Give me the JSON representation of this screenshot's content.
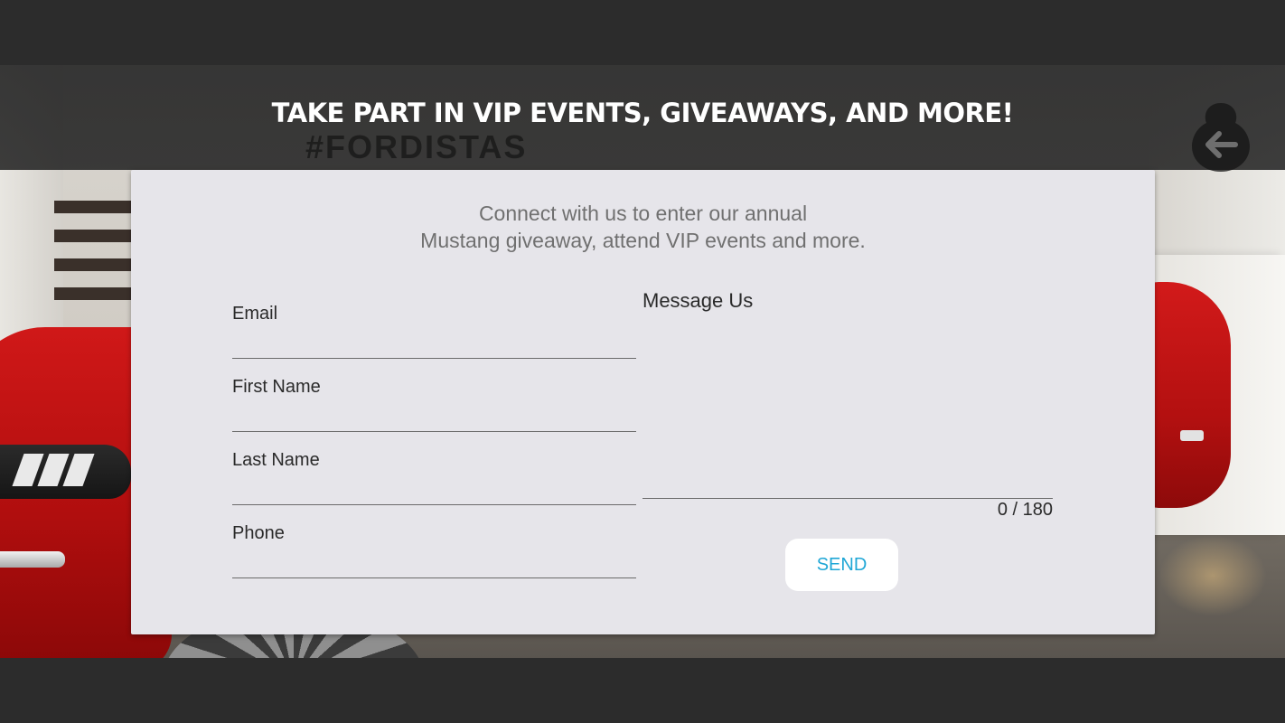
{
  "header": {
    "title": "TAKE PART IN VIP EVENTS, GIVEAWAYS, AND MORE!",
    "background_text": "#FORDISTAS"
  },
  "back_button": {
    "icon": "back-arrow-icon"
  },
  "form": {
    "intro_line1": "Connect with us to enter our annual",
    "intro_line2": "Mustang giveaway, attend VIP events and more.",
    "fields": [
      {
        "label": "Email",
        "value": ""
      },
      {
        "label": "First Name",
        "value": ""
      },
      {
        "label": "Last Name",
        "value": ""
      },
      {
        "label": "Phone",
        "value": ""
      }
    ],
    "message": {
      "label": "Message Us",
      "value": "",
      "counter": "0 / 180"
    },
    "send_label": "SEND"
  },
  "colors": {
    "card_background": "#e6e5ea",
    "send_text": "#20a7d6",
    "header_text": "#ffffff"
  }
}
